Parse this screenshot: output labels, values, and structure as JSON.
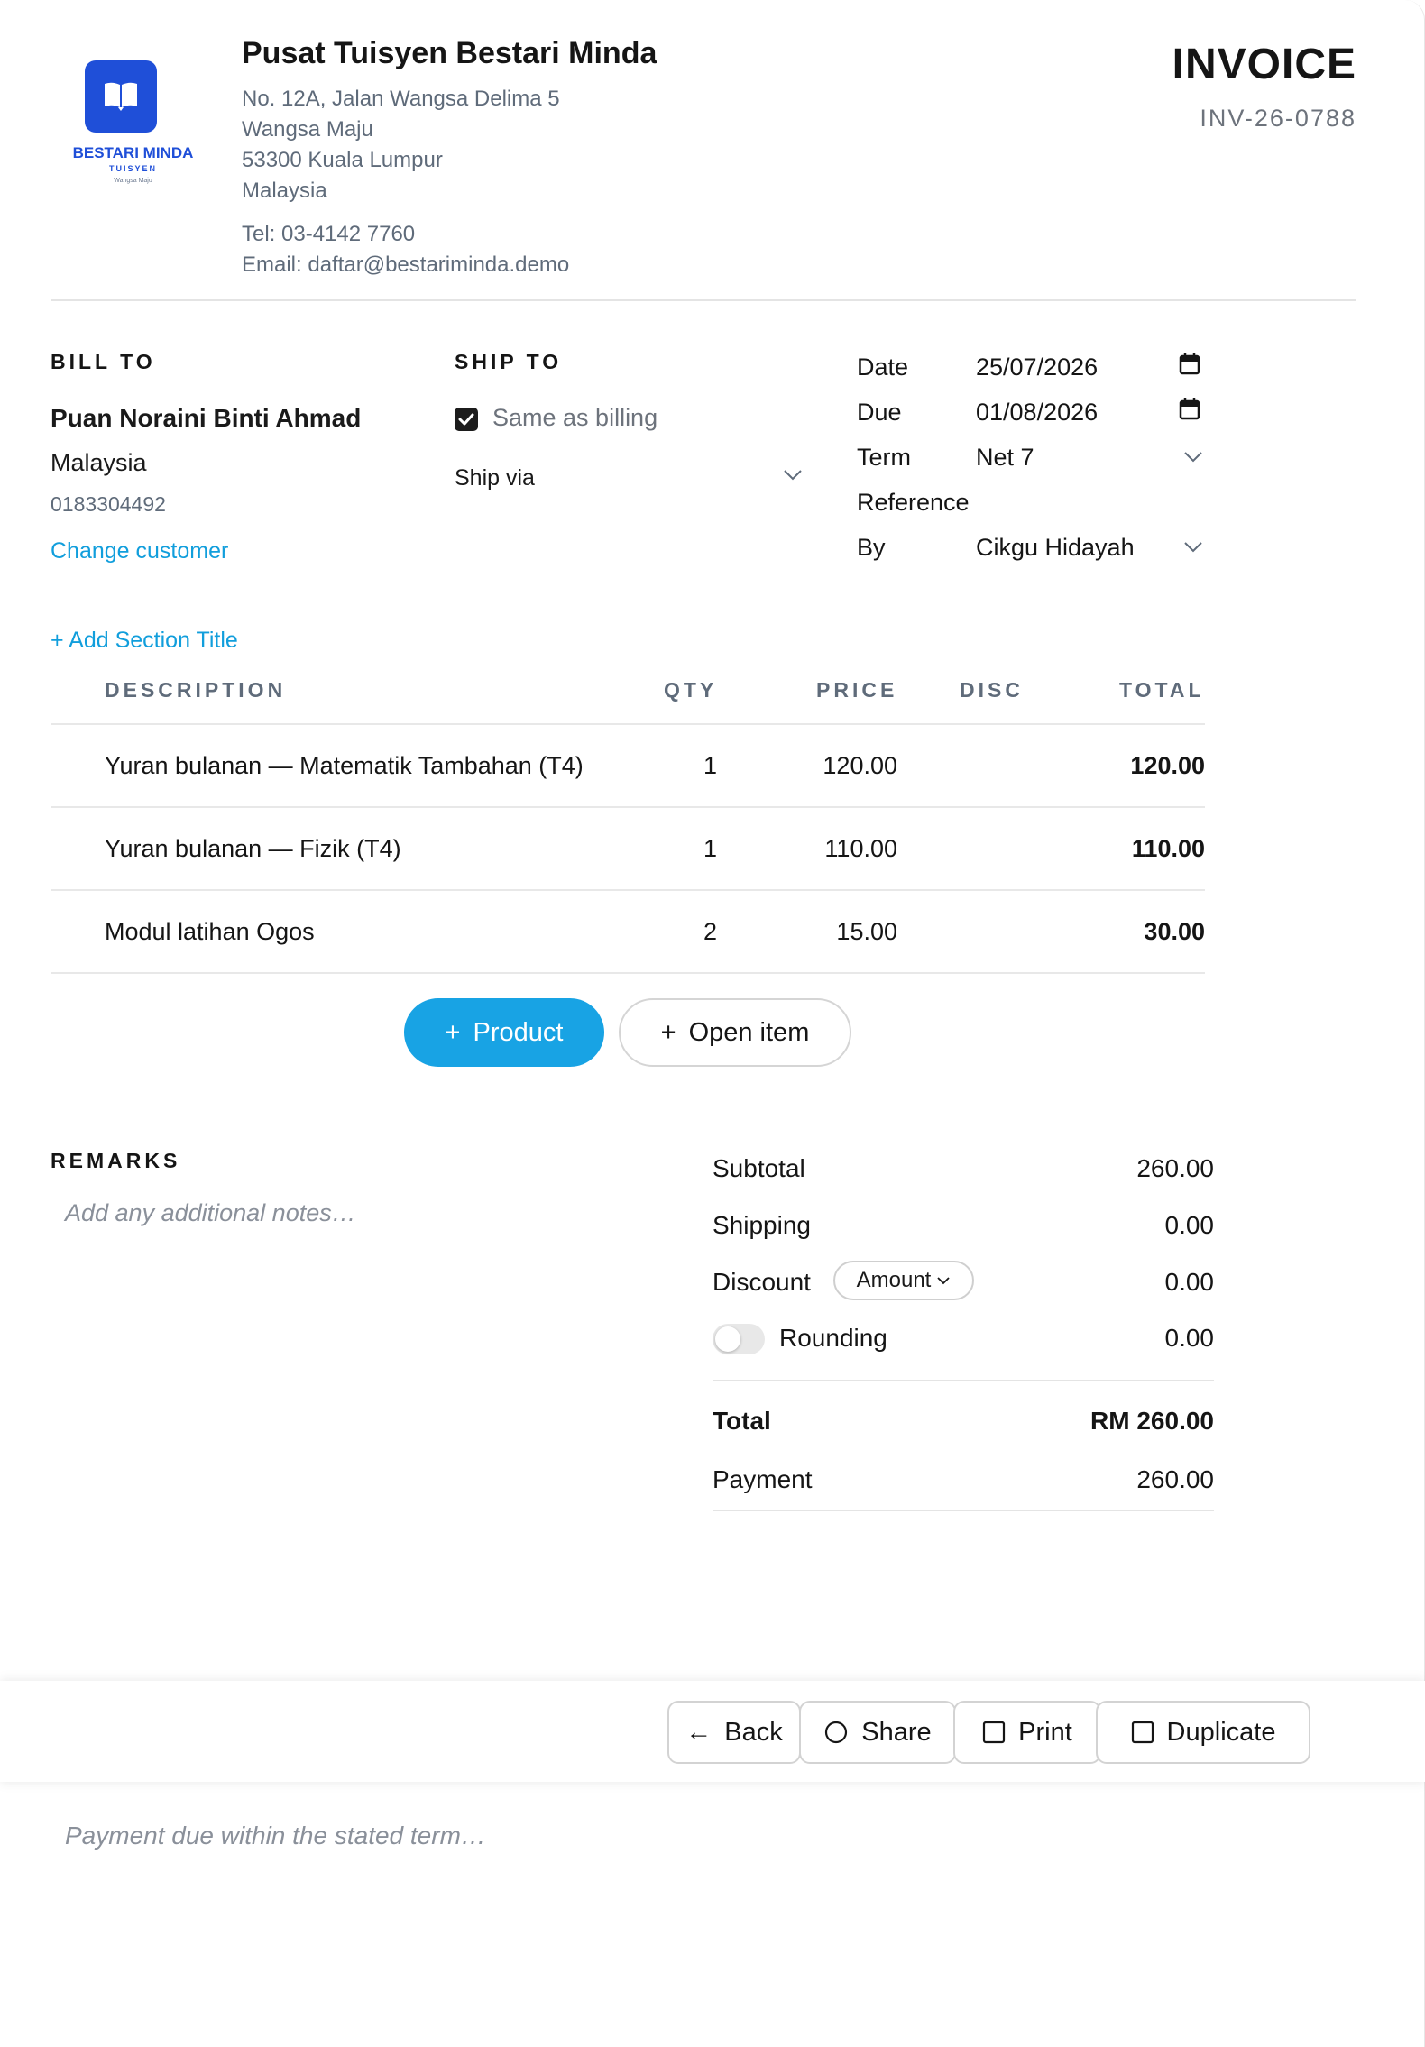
{
  "company": {
    "logo_name": "BESTARI MINDA",
    "logo_sub": "TUISYEN",
    "logo_place": "Wangsa Maju",
    "name": "Pusat Tuisyen Bestari Minda",
    "address": [
      "No. 12A, Jalan Wangsa Delima 5",
      "Wangsa Maju",
      "53300 Kuala Lumpur",
      "Malaysia"
    ],
    "tel": "Tel: 03-4142 7760",
    "email": "Email: daftar@bestariminda.demo",
    "logo_icon": "book-icon",
    "brand_color": "#1f4fd8"
  },
  "invoice": {
    "title": "INVOICE",
    "number": "INV-26-0788"
  },
  "bill_to": {
    "label": "BILL TO",
    "name": "Puan Noraini Binti Ahmad",
    "country": "Malaysia",
    "phone": "0183304492",
    "change_link": "Change customer"
  },
  "ship_to": {
    "label": "SHIP TO",
    "same_as_billing": "Same as billing",
    "same_checked": true,
    "ship_via": "Ship via"
  },
  "meta": {
    "date_label": "Date",
    "date_value": "25/07/2026",
    "due_label": "Due",
    "due_value": "01/08/2026",
    "term_label": "Term",
    "term_value": "Net 7",
    "reference_label": "Reference",
    "by_label": "By",
    "by_value": "Cikgu Hidayah"
  },
  "items": {
    "add_section": "+ Add Section Title",
    "headers": {
      "description": "DESCRIPTION",
      "qty": "QTY",
      "price": "PRICE",
      "disc": "DISC",
      "total": "TOTAL"
    },
    "rows": [
      {
        "description": "Yuran bulanan — Matematik Tambahan (T4)",
        "qty": "1",
        "price": "120.00",
        "disc": "",
        "total": "120.00"
      },
      {
        "description": "Yuran bulanan — Fizik (T4)",
        "qty": "1",
        "price": "110.00",
        "disc": "",
        "total": "110.00"
      },
      {
        "description": "Modul latihan Ogos",
        "qty": "2",
        "price": "15.00",
        "disc": "",
        "total": "30.00"
      }
    ],
    "product_button": "Product",
    "open_item_button": "Open item"
  },
  "remarks": {
    "label": "REMARKS",
    "placeholder": "Add any additional notes…"
  },
  "summary": {
    "subtotal_label": "Subtotal",
    "subtotal": "260.00",
    "shipping_label": "Shipping",
    "shipping": "0.00",
    "discount_label": "Discount",
    "discount_mode": "Amount",
    "discount": "0.00",
    "rounding_label": "Rounding",
    "rounding": "0.00",
    "rounding_on": false,
    "total_label": "Total",
    "total": "RM 260.00",
    "payment_label": "Payment",
    "payment": "260.00"
  },
  "footer": {
    "back": "Back",
    "share": "Share",
    "print": "Print",
    "duplicate": "Duplicate",
    "terms_placeholder": "Payment due within the stated term…"
  },
  "colors": {
    "accent": "#18a3e4",
    "link": "#119edc"
  }
}
